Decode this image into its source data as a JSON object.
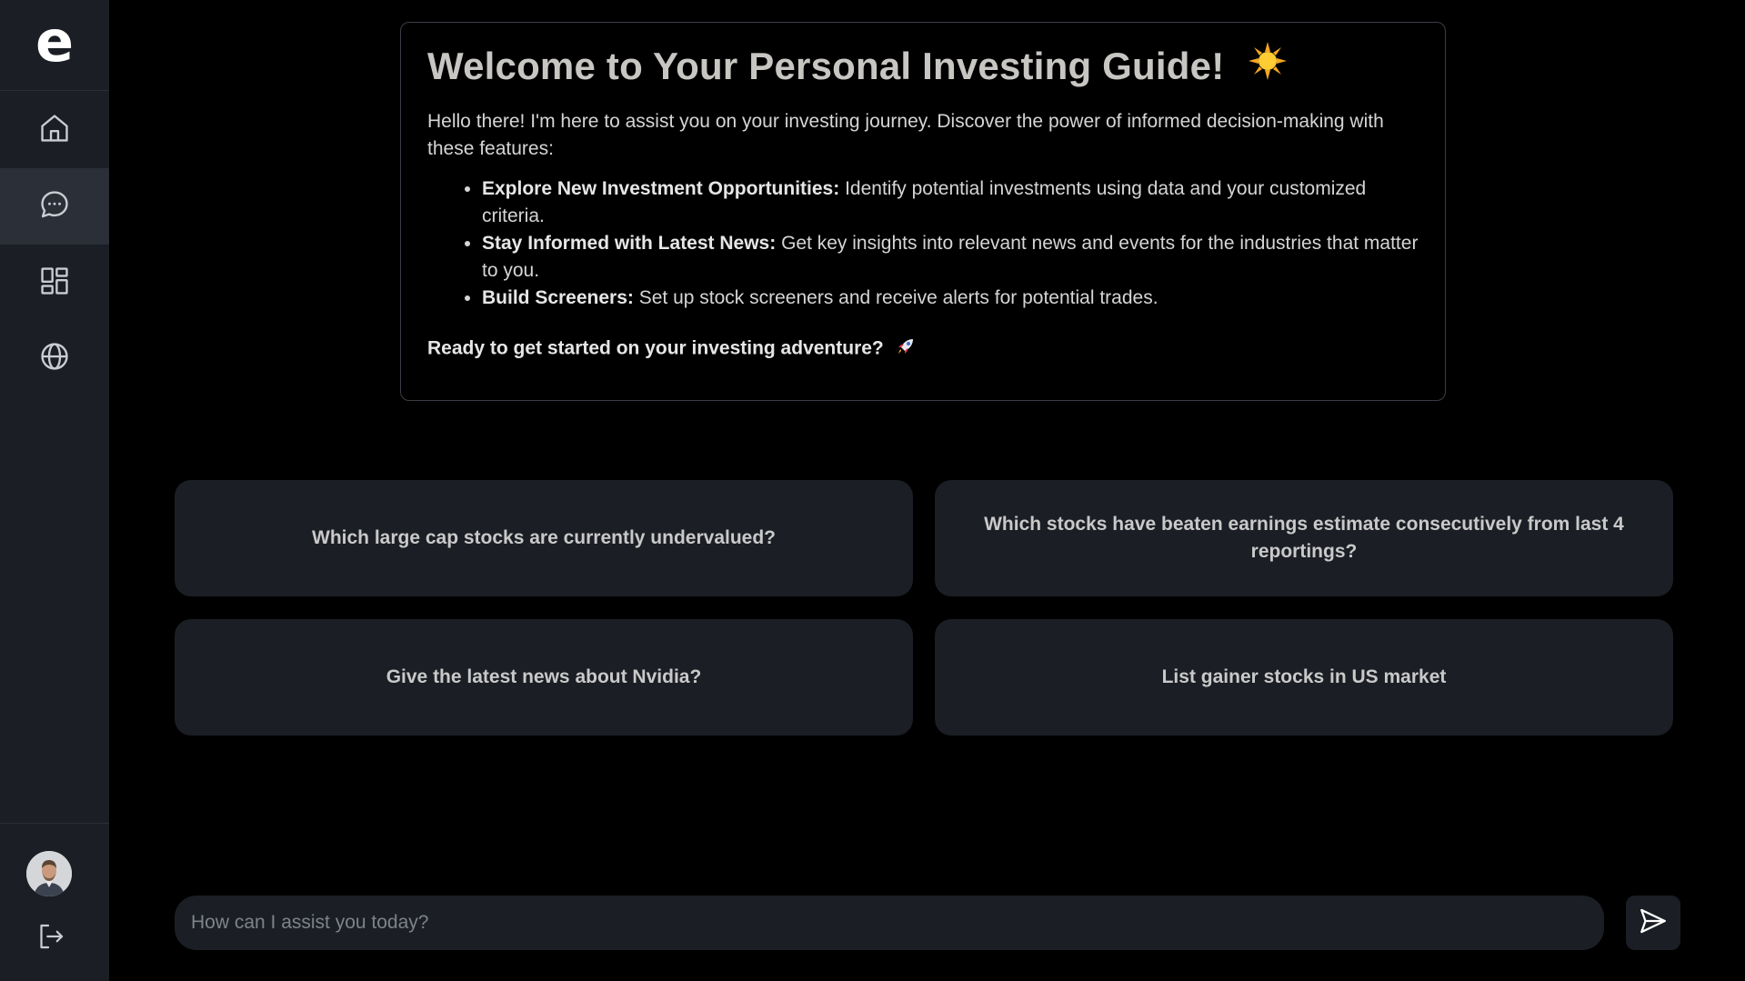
{
  "sidebar": {
    "logo": "e",
    "items": [
      {
        "name": "home",
        "icon": "home-icon",
        "active": false
      },
      {
        "name": "chat",
        "icon": "chat-bubble-icon",
        "active": true
      },
      {
        "name": "dashboard",
        "icon": "grid-icon",
        "active": false
      },
      {
        "name": "explore",
        "icon": "globe-icon",
        "active": false
      }
    ],
    "logout_icon": "logout-icon"
  },
  "welcome": {
    "title": "Welcome to Your Personal Investing Guide!",
    "title_icon": "sun-icon",
    "intro": "Hello there! I'm here to assist you on your investing journey. Discover the power of informed decision-making with these features:",
    "features": [
      {
        "title": "Explore New Investment Opportunities:",
        "text": " Identify potential investments using data and your customized criteria."
      },
      {
        "title": "Stay Informed with Latest News:",
        "text": " Get key insights into relevant news and events for the industries that matter to you."
      },
      {
        "title": "Build Screeners:",
        "text": " Set up stock screeners and receive alerts for potential trades."
      }
    ],
    "cta": "Ready to get started on your investing adventure?",
    "cta_icon": "rocket-icon"
  },
  "suggestions": [
    "Which large cap stocks are currently undervalued?",
    "Which stocks have beaten earnings estimate consecutively from last 4 reportings?",
    "Give the latest news about Nvidia?",
    "List gainer stocks in US market"
  ],
  "chat": {
    "placeholder": "How can I assist you today?",
    "value": ""
  },
  "colors": {
    "background": "#000000",
    "sidebar": "#1b1e24",
    "active_nav": "#2a2f38",
    "card": "#1b1e24",
    "card_border": "#3a3e45"
  }
}
